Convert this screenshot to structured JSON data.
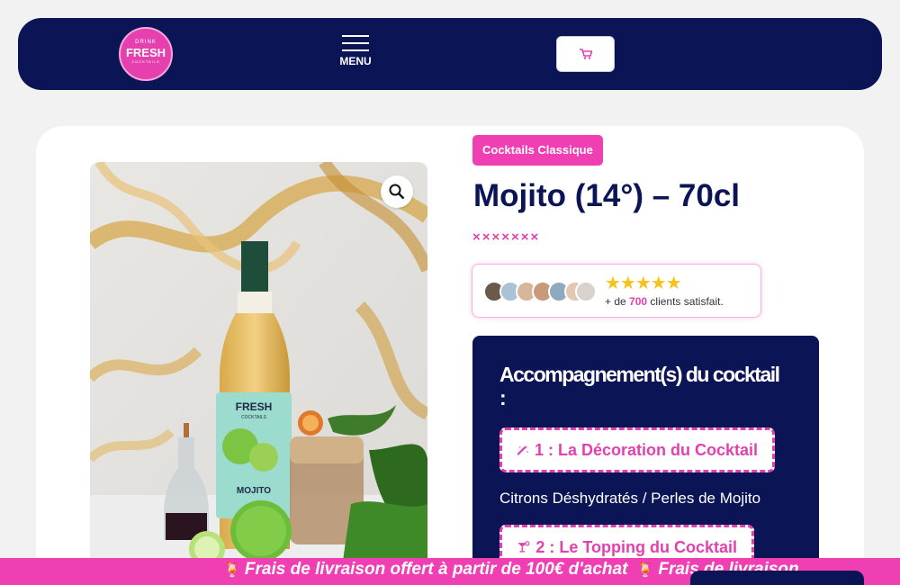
{
  "header": {
    "logo": {
      "line1": "DRINK",
      "brand": "FRESH",
      "line3": "COCKTAILS"
    },
    "menu_label": "MENU",
    "cart_icon": "cart-icon"
  },
  "product": {
    "category": "Cocktails Classique",
    "title": "Mojito (14°) – 70cl",
    "crosses": "×××××××",
    "rating": {
      "stars": "★★★★★",
      "text_prefix": "+ de",
      "count": "700",
      "text_suffix": "clients satisfait."
    },
    "image": {
      "bottle_brand": "FRESH",
      "bottle_sub": "COCKTAILS",
      "bottle_flavor": "MOJITO"
    }
  },
  "accompaniment": {
    "heading": "Accompagnement(s) du cocktail :",
    "options": [
      {
        "label": "1 : La Décoration du Cocktail",
        "icon": "magic-wand-icon"
      },
      {
        "label": "2 : Le Topping du Cocktail",
        "icon": "cocktail-glass-icon"
      }
    ],
    "option1_description": "Citrons Déshydratés / Perles de Mojito"
  },
  "ticker": {
    "message": "Frais de livraison offert à partir de 100€ d'achat",
    "message_partial": "Frais de livraison"
  },
  "colors": {
    "navy": "#0b1555",
    "pink": "#ef3fb3",
    "star": "#f7c21a"
  }
}
